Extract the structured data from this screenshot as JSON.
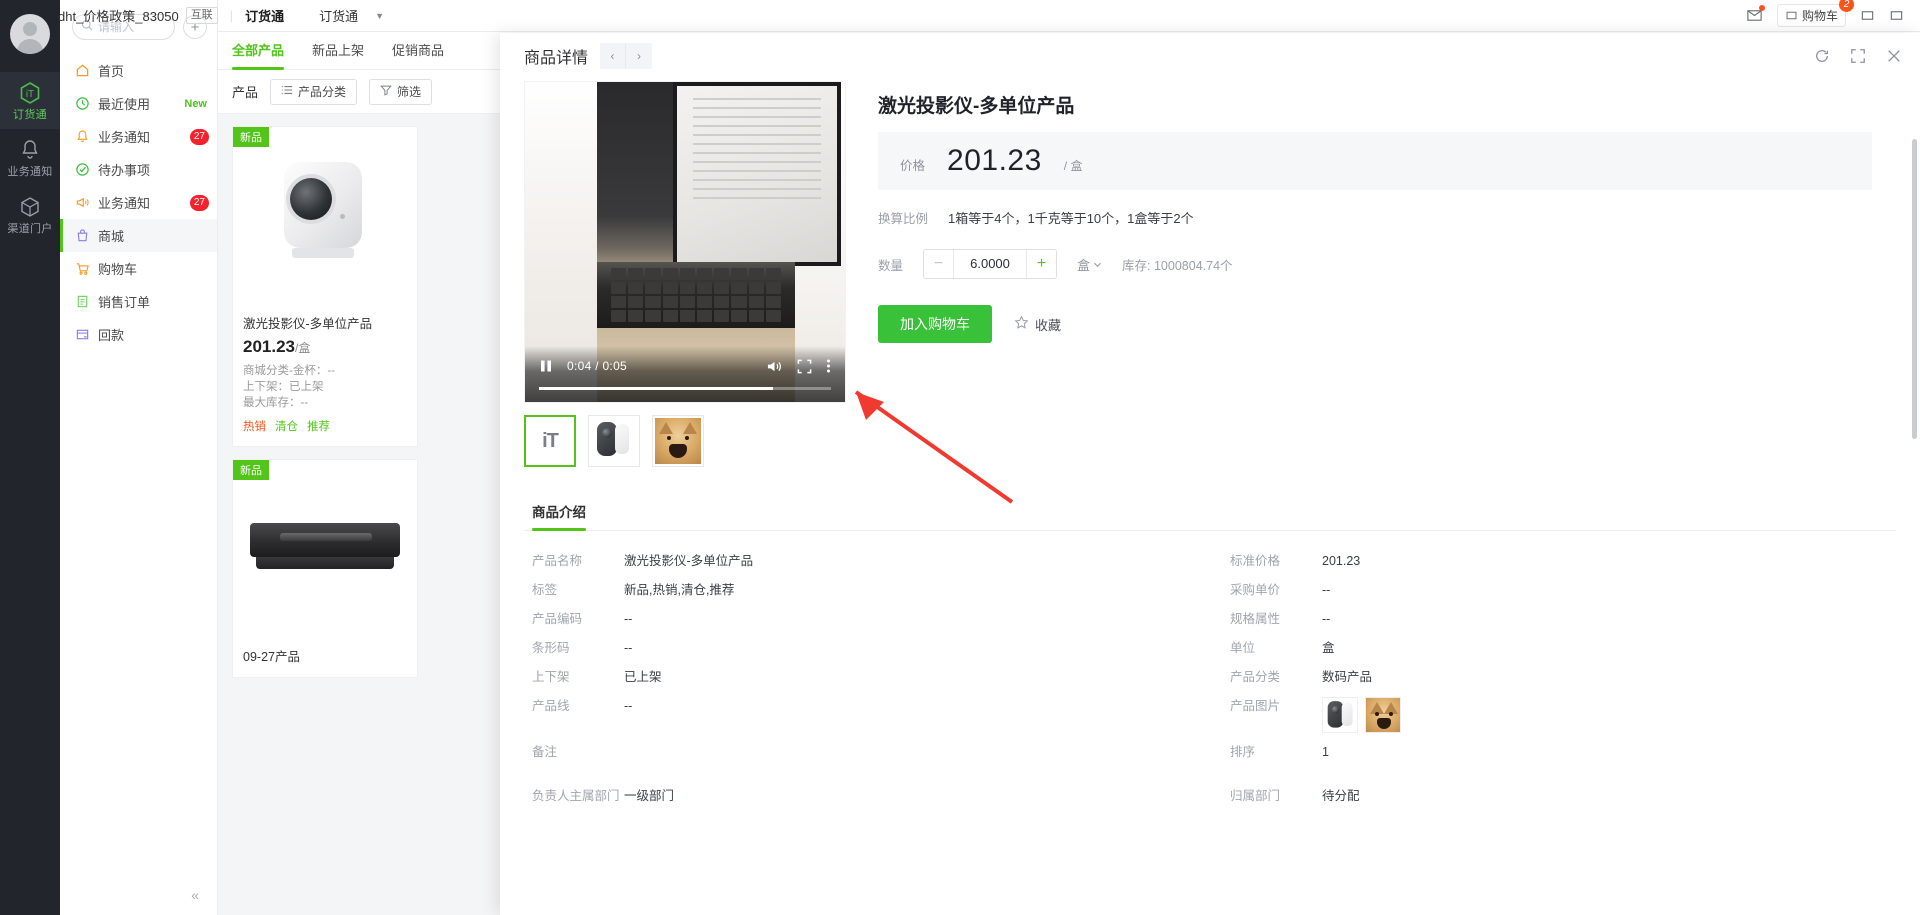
{
  "rail": {
    "avatar": "user-avatar",
    "items": [
      {
        "label": "订货通",
        "icon": "hexagon-logo-icon",
        "active": true
      },
      {
        "label": "业务通知",
        "icon": "bell-icon",
        "active": false
      },
      {
        "label": "渠道门户",
        "icon": "cube-icon",
        "active": false
      }
    ]
  },
  "nav": {
    "search_placeholder": "请输入",
    "search_value": "",
    "add_label": "+",
    "items": [
      {
        "label": "首页",
        "icon": "home-icon",
        "badge": "",
        "badge_type": "",
        "active": false
      },
      {
        "label": "最近使用",
        "icon": "clock-icon",
        "badge": "New",
        "badge_type": "new",
        "active": false
      },
      {
        "label": "业务通知",
        "icon": "bell-icon",
        "badge": "27",
        "badge_type": "num",
        "active": false
      },
      {
        "label": "待办事项",
        "icon": "check-circle-icon",
        "badge": "",
        "badge_type": "",
        "active": false
      },
      {
        "label": "业务通知",
        "icon": "megaphone-icon",
        "badge": "27",
        "badge_type": "num",
        "active": false
      },
      {
        "label": "商城",
        "icon": "shop-bag-icon",
        "badge": "",
        "badge_type": "",
        "active": true
      },
      {
        "label": "购物车",
        "icon": "cart-icon",
        "badge": "",
        "badge_type": "",
        "active": false
      },
      {
        "label": "销售订单",
        "icon": "order-list-icon",
        "badge": "",
        "badge_type": "",
        "active": false
      },
      {
        "label": "回款",
        "icon": "payment-icon",
        "badge": "",
        "badge_type": "",
        "active": false
      }
    ],
    "collapse_label": "«"
  },
  "topbar": {
    "tenant": "dht_价格政策_83050",
    "tenant_tag": "互联",
    "app_name": "订货通",
    "app_switcher": "订货通",
    "cart_label": "购物车",
    "cart_badge": "2"
  },
  "list": {
    "tabs": [
      {
        "label": "全部产品",
        "active": true
      },
      {
        "label": "新品上架",
        "active": false
      },
      {
        "label": "促销商品",
        "active": false
      }
    ],
    "filter_label": "产品",
    "filter_buttons": [
      {
        "label": "产品分类",
        "icon": "category-icon"
      },
      {
        "label": "筛选",
        "icon": "funnel-icon"
      }
    ],
    "cards": [
      {
        "flag": "新品",
        "name": "激光投影仪-多单位产品",
        "price": "201.23",
        "unit": "/盒",
        "meta": [
          "商城分类-金杯：--",
          "上下架：已上架",
          "最大库存：--"
        ],
        "tags": [
          "热销",
          "清仓",
          "推荐"
        ]
      },
      {
        "flag": "新品",
        "name": "09-27产品",
        "price": "",
        "unit": "",
        "meta": [],
        "tags": []
      }
    ]
  },
  "drawer": {
    "title": "商品详情",
    "prev_label": "‹",
    "next_label": "›",
    "refresh_icon": "refresh-icon",
    "expand_icon": "fullscreen-icon",
    "close_icon": "close-icon",
    "player": {
      "state_icon": "pause-icon",
      "time": "0:04 / 0:05",
      "volume_icon": "volume-icon",
      "fullscreen_icon": "fullscreen-icon",
      "more_icon": "more-vertical-icon",
      "progress_percent": 80
    },
    "thumbnails": [
      {
        "name": "logo-thumbnail",
        "label": "iT",
        "active": true
      },
      {
        "name": "camera-thumbnail",
        "label": "",
        "active": false
      },
      {
        "name": "doge-thumbnail",
        "label": "",
        "active": false
      }
    ],
    "product": {
      "title": "激光投影仪-多单位产品",
      "price_label": "价格",
      "price_value": "201.23",
      "price_unit": "/ 盒",
      "conversion_label": "换算比例",
      "conversion_value": "1箱等于4个，1千克等于10个，1盒等于2个",
      "qty_label": "数量",
      "qty_minus": "−",
      "qty_value": "6.0000",
      "qty_plus": "+",
      "qty_unit": "盒",
      "stock_text": "库存: 1000804.74个",
      "add_cart_label": "加入购物车",
      "favorite_label": "收藏"
    },
    "section_tabs": [
      {
        "label": "商品介绍",
        "active": true
      }
    ],
    "details_left": [
      {
        "key": "产品名称",
        "value": "激光投影仪-多单位产品"
      },
      {
        "key": "标签",
        "value": "新品,热销,清仓,推荐"
      },
      {
        "key": "产品编码",
        "value": "--"
      },
      {
        "key": "条形码",
        "value": "--"
      },
      {
        "key": "上下架",
        "value": "已上架"
      },
      {
        "key": "产品线",
        "value": "--"
      },
      {
        "key": "备注",
        "value": ""
      },
      {
        "key": "负责人主属部门",
        "value": "一级部门"
      }
    ],
    "details_right": [
      {
        "key": "标准价格",
        "value": "201.23"
      },
      {
        "key": "采购单价",
        "value": "--"
      },
      {
        "key": "规格属性",
        "value": "--"
      },
      {
        "key": "单位",
        "value": "盒"
      },
      {
        "key": "产品分类",
        "value": "数码产品"
      },
      {
        "key": "产品图片",
        "value": "",
        "images": [
          "camera-image",
          "doge-image"
        ]
      },
      {
        "key": "排序",
        "value": "1"
      },
      {
        "key": "归属部门",
        "value": "待分配"
      }
    ]
  },
  "colors": {
    "accent_green": "#52c41a",
    "button_green": "#3ac13a",
    "badge_red": "#f5222d",
    "cart_orange": "#fa541c",
    "arrow_red": "#f03a2f"
  }
}
